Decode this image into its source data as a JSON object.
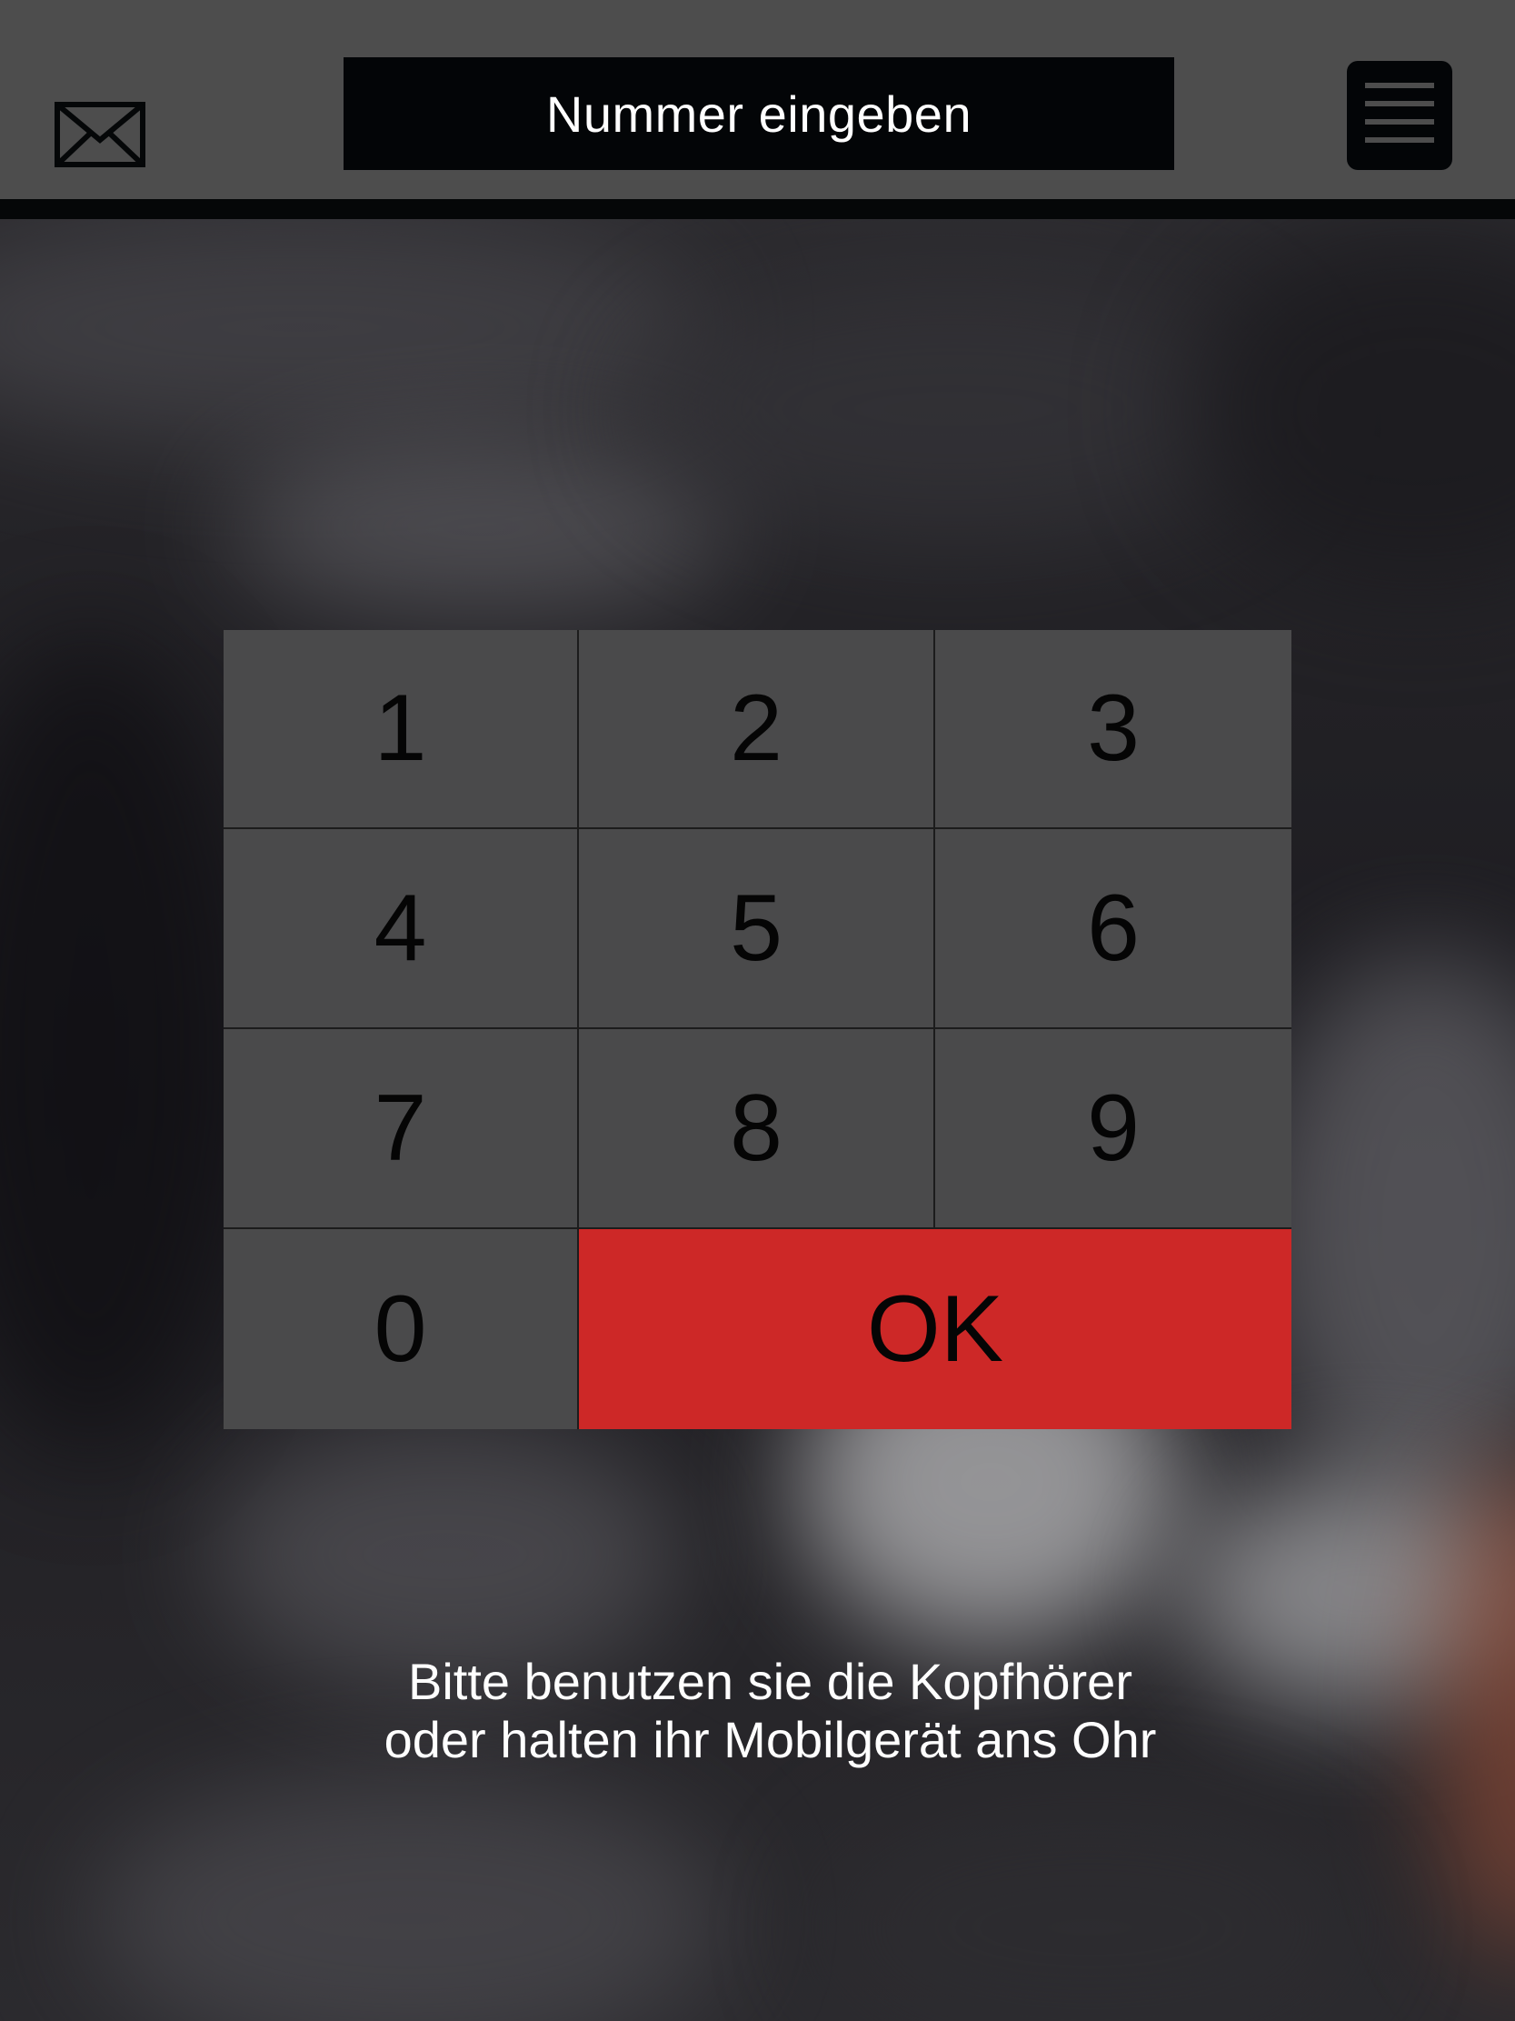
{
  "header": {
    "title": "Nummer eingeben",
    "mail_icon": "envelope-icon",
    "menu_icon": "hamburger-menu-icon"
  },
  "keypad": {
    "keys": [
      "1",
      "2",
      "3",
      "4",
      "5",
      "6",
      "7",
      "8",
      "9",
      "0"
    ],
    "ok_label": "OK"
  },
  "instruction": {
    "line1": "Bitte benutzen sie die Kopfhörer",
    "line2": "oder halten ihr Mobilgerät ans Ohr"
  },
  "colors": {
    "header_bg": "#4d4d4d",
    "title_bg": "#030507",
    "key_bg": "#4a4a4b",
    "ok_bg": "#cd2827",
    "text_light": "#ffffff"
  }
}
